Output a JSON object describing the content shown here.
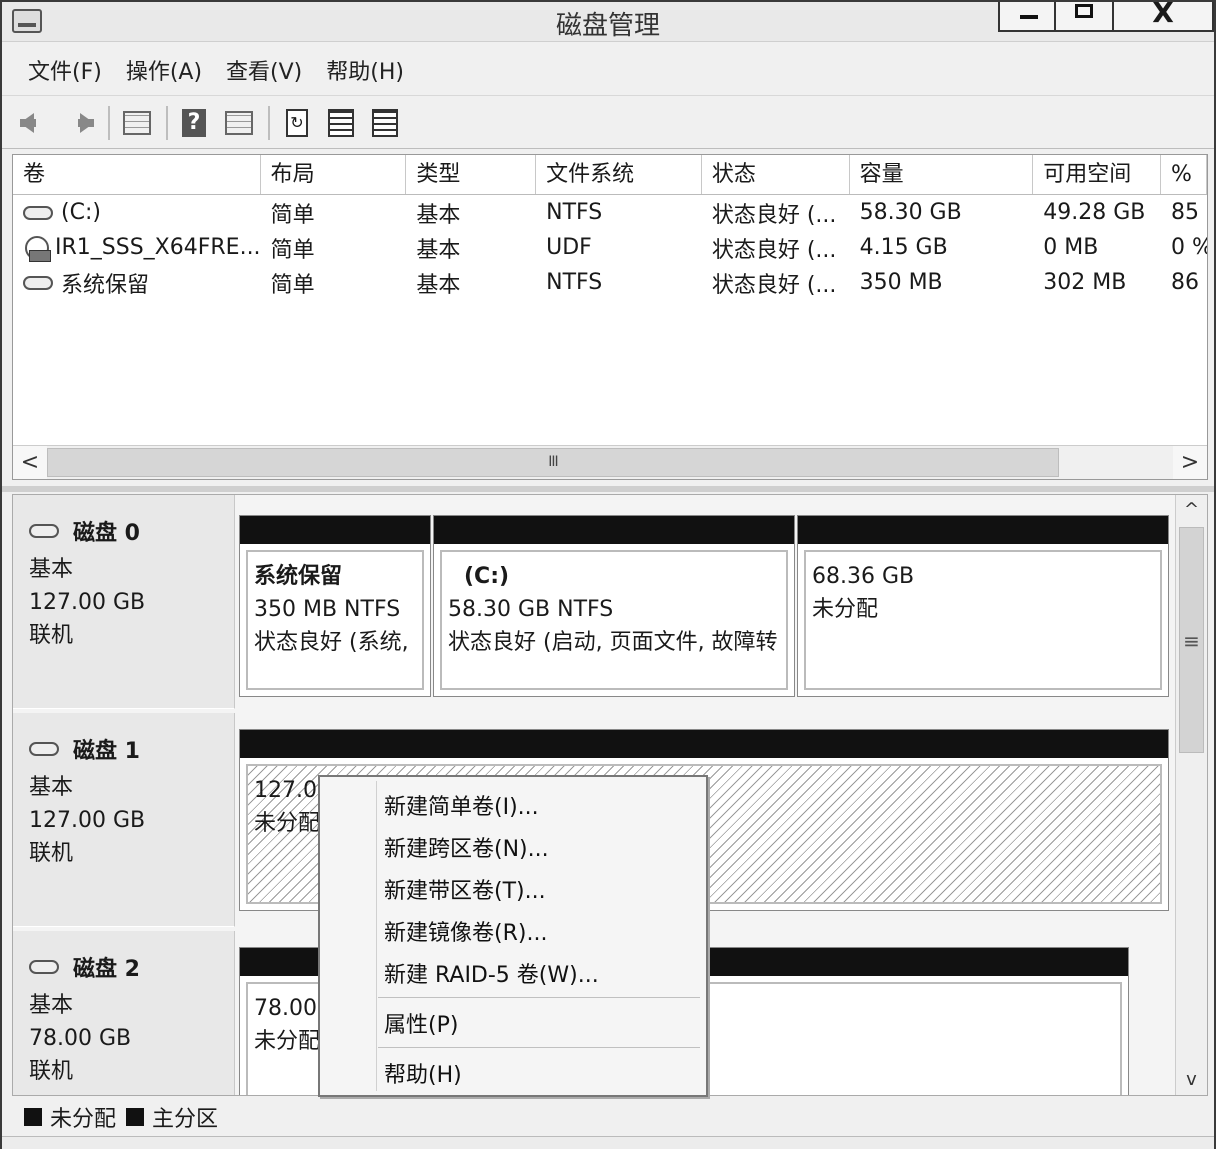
{
  "window": {
    "title": "磁盘管理",
    "close_glyph": "X"
  },
  "menu": [
    "文件(F)",
    "操作(A)",
    "查看(V)",
    "帮助(H)"
  ],
  "toolbar": [
    "back-icon",
    "forward-icon",
    "console-tree-icon",
    "help-icon",
    "view-icon",
    "refresh-icon",
    "properties-icon",
    "disk-icon"
  ],
  "columns": [
    "卷",
    "布局",
    "类型",
    "文件系统",
    "状态",
    "容量",
    "可用空间",
    "% "
  ],
  "volumes": [
    {
      "name": "(C:)",
      "layout": "简单",
      "type": "基本",
      "fs": "NTFS",
      "status": "状态良好 (...",
      "capacity": "58.30 GB",
      "free": "49.28 GB",
      "pct": "85"
    },
    {
      "name": "IR1_SSS_X64FRE...",
      "layout": "简单",
      "type": "基本",
      "fs": "UDF",
      "status": "状态良好 (...",
      "capacity": "4.15 GB",
      "free": "0 MB",
      "pct": "0 %"
    },
    {
      "name": "系统保留",
      "layout": "简单",
      "type": "基本",
      "fs": "NTFS",
      "status": "状态良好 (...",
      "capacity": "350 MB",
      "free": "302 MB",
      "pct": "86"
    }
  ],
  "hscroll": {
    "left": "<",
    "right": ">",
    "grip": "III"
  },
  "vscroll": {
    "up": "^",
    "down": "v",
    "grip": "≡"
  },
  "disks": [
    {
      "name": "磁盘 0",
      "kind": "基本",
      "size": "127.00 GB",
      "state": "联机",
      "partitions": [
        {
          "name": "系统保留",
          "line1": "350 MB NTFS",
          "line2": "状态良好 (系统,"
        },
        {
          "name": "(C:)",
          "line1": "58.30 GB NTFS",
          "line2": "状态良好 (启动, 页面文件, 故障转"
        },
        {
          "name": "",
          "line1": "68.36 GB",
          "line2": "未分配"
        }
      ]
    },
    {
      "name": "磁盘 1",
      "kind": "基本",
      "size": "127.00 GB",
      "state": "联机",
      "partitions": [
        {
          "name": "",
          "line1": "127.0",
          "line2": "未分配"
        }
      ]
    },
    {
      "name": "磁盘 2",
      "kind": "基本",
      "size": "78.00 GB",
      "state": "联机",
      "partitions": [
        {
          "name": "",
          "line1": "78.00",
          "line2": "未分配"
        }
      ]
    }
  ],
  "legend": [
    "未分配",
    "主分区"
  ],
  "context_menu": {
    "items": [
      "新建简单卷(I)...",
      "新建跨区卷(N)...",
      "新建带区卷(T)...",
      "新建镜像卷(R)...",
      "新建 RAID-5 卷(W)..."
    ],
    "properties": "属性(P)",
    "help": "帮助(H)"
  }
}
